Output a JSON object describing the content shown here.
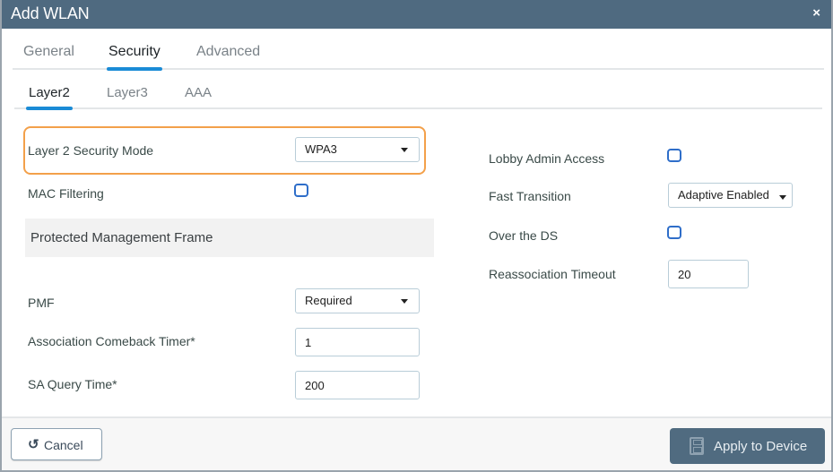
{
  "window": {
    "title": "Add WLAN",
    "close_label": "×"
  },
  "tabs": [
    {
      "label": "General",
      "active": false
    },
    {
      "label": "Security",
      "active": true
    },
    {
      "label": "Advanced",
      "active": false
    }
  ],
  "subtabs": [
    {
      "label": "Layer2",
      "active": true
    },
    {
      "label": "Layer3",
      "active": false
    },
    {
      "label": "AAA",
      "active": false
    }
  ],
  "left": {
    "layer2_security_mode": {
      "label": "Layer 2 Security Mode",
      "value": "WPA3"
    },
    "mac_filtering": {
      "label": "MAC Filtering",
      "checked": false
    },
    "section_title": "Protected Management Frame",
    "pmf": {
      "label": "PMF",
      "value": "Required"
    },
    "assoc_comeback_timer": {
      "label": "Association Comeback Timer*",
      "value": "1"
    },
    "sa_query_time": {
      "label": "SA Query Time*",
      "value": "200"
    }
  },
  "right": {
    "lobby_admin_access": {
      "label": "Lobby Admin Access",
      "checked": false
    },
    "fast_transition": {
      "label": "Fast Transition",
      "value": "Adaptive Enabled"
    },
    "over_the_ds": {
      "label": "Over the DS",
      "checked": false
    },
    "reassociation_timeout": {
      "label": "Reassociation Timeout",
      "value": "20"
    }
  },
  "footer": {
    "cancel_label": "Cancel",
    "cancel_icon": "↺",
    "apply_label": "Apply to Device"
  },
  "colors": {
    "titlebar": "#4f6a80",
    "accent_tab": "#1a8bd6",
    "highlight": "#f3a04a",
    "checkbox": "#2f6ec9",
    "apply_button": "#506b80"
  }
}
